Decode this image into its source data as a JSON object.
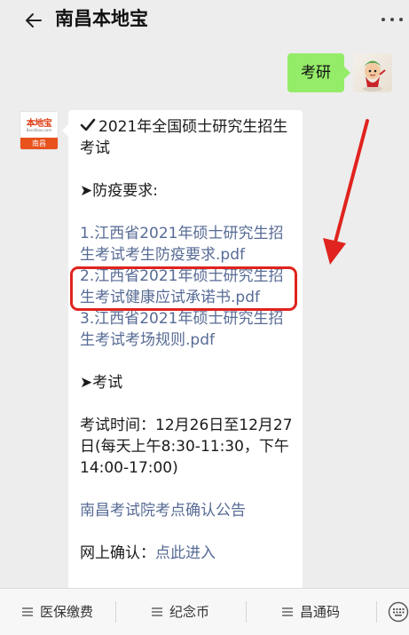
{
  "header": {
    "title": "南昌本地宝",
    "back_icon": "arrow-left-icon",
    "more_icon": "more-dots-icon"
  },
  "outgoing": {
    "text": "考研",
    "bubble_color": "#95ec69"
  },
  "incoming": {
    "avatar": {
      "top_text": "本地宝",
      "url_text": "Bendibao.com",
      "bottom_text": "南昌"
    },
    "title_check_icon": "check-icon",
    "title": "2021年全国硕士研究生招生考试",
    "section1": "➤防疫要求:",
    "links": [
      "1.江西省2021年硕士研究生招生考试考生防疫要求.pdf",
      "2.江西省2021年硕士研究生招生考试健康应试承诺书.pdf",
      "3.江西省2021年硕士研究生招生考试考场规则.pdf"
    ],
    "section2": "➤考试",
    "exam_time": "考试时间：12月26日至12月27日(每天上午8:30-11:30，下午14:00-17:00)",
    "notice_link": "南昌考试院考点确认公告",
    "confirm_label": "网上确认：",
    "confirm_link": "点此进入",
    "link_color": "#576b95"
  },
  "annotation": {
    "color": "#e0231e"
  },
  "menu": {
    "items": [
      "医保缴费",
      "纪念币",
      "昌通码"
    ],
    "keyboard_icon": "keyboard-icon"
  }
}
